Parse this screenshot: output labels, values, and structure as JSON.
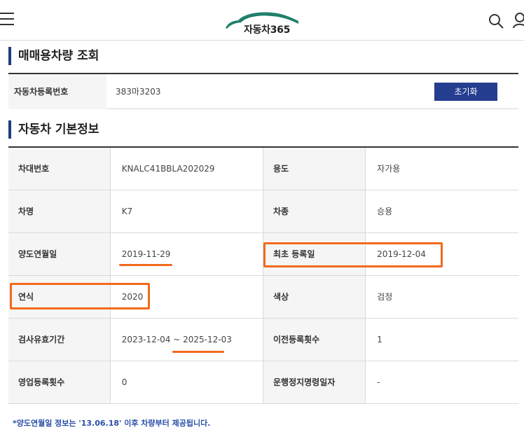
{
  "header": {
    "logo_text": "자동차365",
    "menu_icon": "hamburger-menu-icon",
    "search_icon": "search-icon",
    "user_icon": "user-icon"
  },
  "search_section": {
    "title": "매매용차량 조회",
    "label": "자동차등록번호",
    "value": "383마3203",
    "reset_label": "초기화"
  },
  "info_section": {
    "title": "자동차 기본정보",
    "rows": [
      {
        "l1": "차대번호",
        "v1": "KNALC41BBLA202029",
        "l2": "용도",
        "v2": "자가용"
      },
      {
        "l1": "차명",
        "v1": "K7",
        "l2": "차종",
        "v2": "승용"
      },
      {
        "l1": "양도연월일",
        "v1": "2019-11-29",
        "l2": "최초 등록일",
        "v2": "2019-12-04"
      },
      {
        "l1": "연식",
        "v1": "2020",
        "l2": "색상",
        "v2": "검정"
      },
      {
        "l1": "검사유효기간",
        "v1": "2023-12-04 ~ 2025-12-03",
        "l2": "이전등록횟수",
        "v2": "1"
      },
      {
        "l1": "영업등록횟수",
        "v1": "0",
        "l2": "운행정지명령일자",
        "v2": "-"
      }
    ]
  },
  "note": "*양도연월일 정보는 '13.06.18' 이후 차량부터 제공됩니다.",
  "colors": {
    "accent": "#253e8f",
    "annotation": "#f26a1b",
    "note": "#2a4fa8",
    "logo_car": "#1f7f6a"
  }
}
